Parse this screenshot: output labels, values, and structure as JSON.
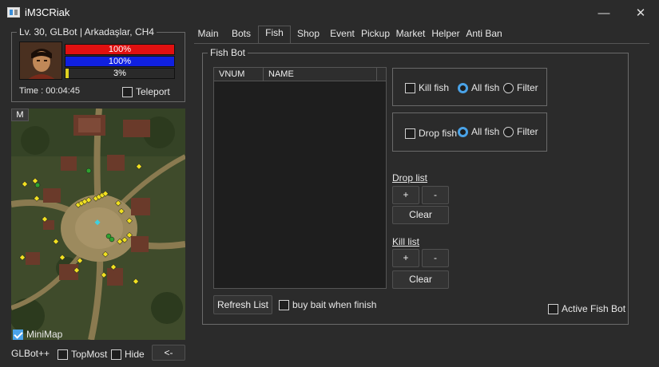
{
  "window": {
    "title": "iM3CRiak",
    "minimize": "—",
    "maximize": "☐",
    "close": "✕"
  },
  "character": {
    "group_title": "Lv. 30, GLBot | Arkadaşlar, CH4",
    "hp_text": "100%",
    "hp": 1.0,
    "mp_text": "100%",
    "mp": 1.0,
    "exp_text": "3%",
    "exp": 0.03,
    "time_text": "Time : 00:04:45",
    "teleport_label": "Teleport"
  },
  "minimap": {
    "m_button": "M",
    "minimap_label": "MiniMap"
  },
  "footer": {
    "brand": "GLBot++",
    "topmost_label": "TopMost",
    "hide_label": "Hide",
    "collapse_button": "<-"
  },
  "tabs": [
    "Main",
    "Bots",
    "Fish",
    "Shop",
    "Event",
    "Pickup",
    "Market",
    "Helper",
    "Anti Ban"
  ],
  "fish": {
    "group_title": "Fish Bot",
    "col_vnum": "VNUM",
    "col_name": "NAME",
    "kill_fish_label": "Kill fish",
    "drop_fish_label": "Drop fish",
    "all_fish_label": "All fish",
    "filter_label": "Filter",
    "drop_list_label": "Drop list",
    "kill_list_label": "Kill list",
    "plus": "+",
    "minus": "-",
    "clear": "Clear",
    "refresh_list": "Refresh List",
    "buy_bait_label": "buy bait when finish",
    "active_label": "Active Fish Bot"
  },
  "colors": {
    "hp": "#e01010",
    "mp": "#1020e0",
    "exp": "#e0d020",
    "accent": "#4aa3e8"
  }
}
